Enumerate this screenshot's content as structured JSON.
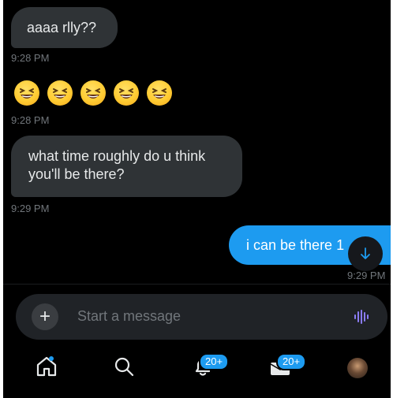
{
  "messages": {
    "m1": {
      "text": "aaaa rlly??",
      "time": "9:28 PM"
    },
    "m2": {
      "emojis": [
        "grinning-squinting-face",
        "grinning-squinting-face",
        "grinning-squinting-face",
        "grinning-squinting-face",
        "grinning-squinting-face"
      ],
      "time": "9:28 PM"
    },
    "m3": {
      "line1": "what time roughly do u think",
      "line2": "you'll be there?",
      "time": "9:29 PM"
    },
    "m4": {
      "text": "i can be there 1",
      "time": "9:29 PM"
    }
  },
  "scroll_button": {
    "icon": "arrow-down-icon"
  },
  "composer": {
    "placeholder": "Start a message",
    "add_icon": "plus-icon",
    "voice_icon": "voice-waveform-icon"
  },
  "nav": {
    "items": [
      {
        "icon": "home-icon"
      },
      {
        "icon": "search-icon"
      },
      {
        "icon": "notifications-bell-icon",
        "badge": "20+"
      },
      {
        "icon": "messages-envelope-icon",
        "badge": "20+"
      },
      {
        "icon": "profile-avatar"
      }
    ]
  },
  "colors": {
    "background": "#000000",
    "incoming_bubble": "#2f3336",
    "outgoing_bubble": "#1d9bf0",
    "timestamp": "#71767b",
    "accent": "#1d9bf0",
    "voice_icon": "#8b7cf6"
  }
}
